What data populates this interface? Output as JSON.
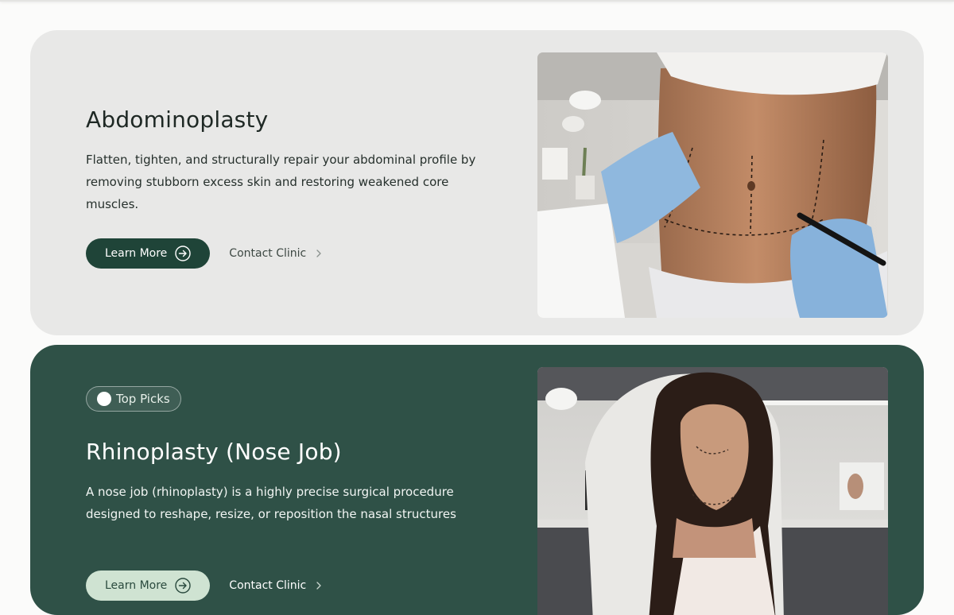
{
  "cards": [
    {
      "title": "Abdominoplasty",
      "description_line1": "Flatten, tighten, and structurally repair your abdominal profile by",
      "description_line2": "removing stubborn excess skin and restoring weakened core muscles.",
      "primary_label": "Learn More",
      "secondary_label": "Contact Clinic",
      "image_alt": "Surgeon marking abdomen with dotted lines before abdominoplasty"
    },
    {
      "badge": "Top Picks",
      "title": "Rhinoplasty (Nose Job)",
      "description_line1": "A nose job (rhinoplasty) is a highly precise surgical procedure",
      "description_line2": "designed to reshape, resize, or reposition the nasal structures",
      "primary_label": "Learn More",
      "secondary_label": "Contact Clinic",
      "image_alt": "Woman with facial contour markings seated in a clinic chair"
    }
  ],
  "colors": {
    "card1_bg": "#e8e8e7",
    "card2_bg": "#2f5147",
    "button_dark": "#1f4438",
    "button_light": "#cfe3d2"
  },
  "icons": [
    "arrow-circle-right-icon",
    "chevron-right-icon",
    "badge-dot-icon"
  ]
}
